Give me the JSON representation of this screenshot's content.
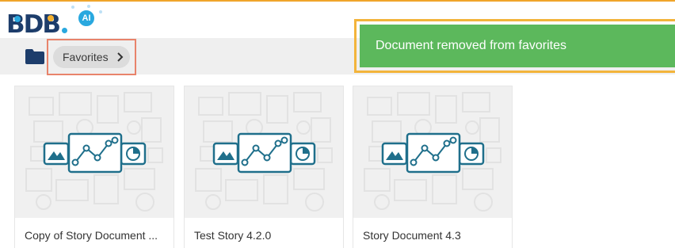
{
  "brand": {
    "name": "BDB",
    "badge": "AI"
  },
  "breadcrumb": {
    "current": "Favorites"
  },
  "toast": {
    "message": "Document removed from favorites"
  },
  "documents": [
    {
      "title": "Copy of Story Document ..."
    },
    {
      "title": "Test Story 4.2.0"
    },
    {
      "title": "Story Document 4.3"
    }
  ],
  "colors": {
    "accent_line": "#f0a52a",
    "toast_bg": "#5cb85c",
    "toast_highlight": "#f3b43b",
    "breadcrumb_highlight": "#e8836b",
    "brand_navy": "#1d3d6b",
    "brand_blue": "#29a8df",
    "icon_teal": "#1f6f8b"
  }
}
